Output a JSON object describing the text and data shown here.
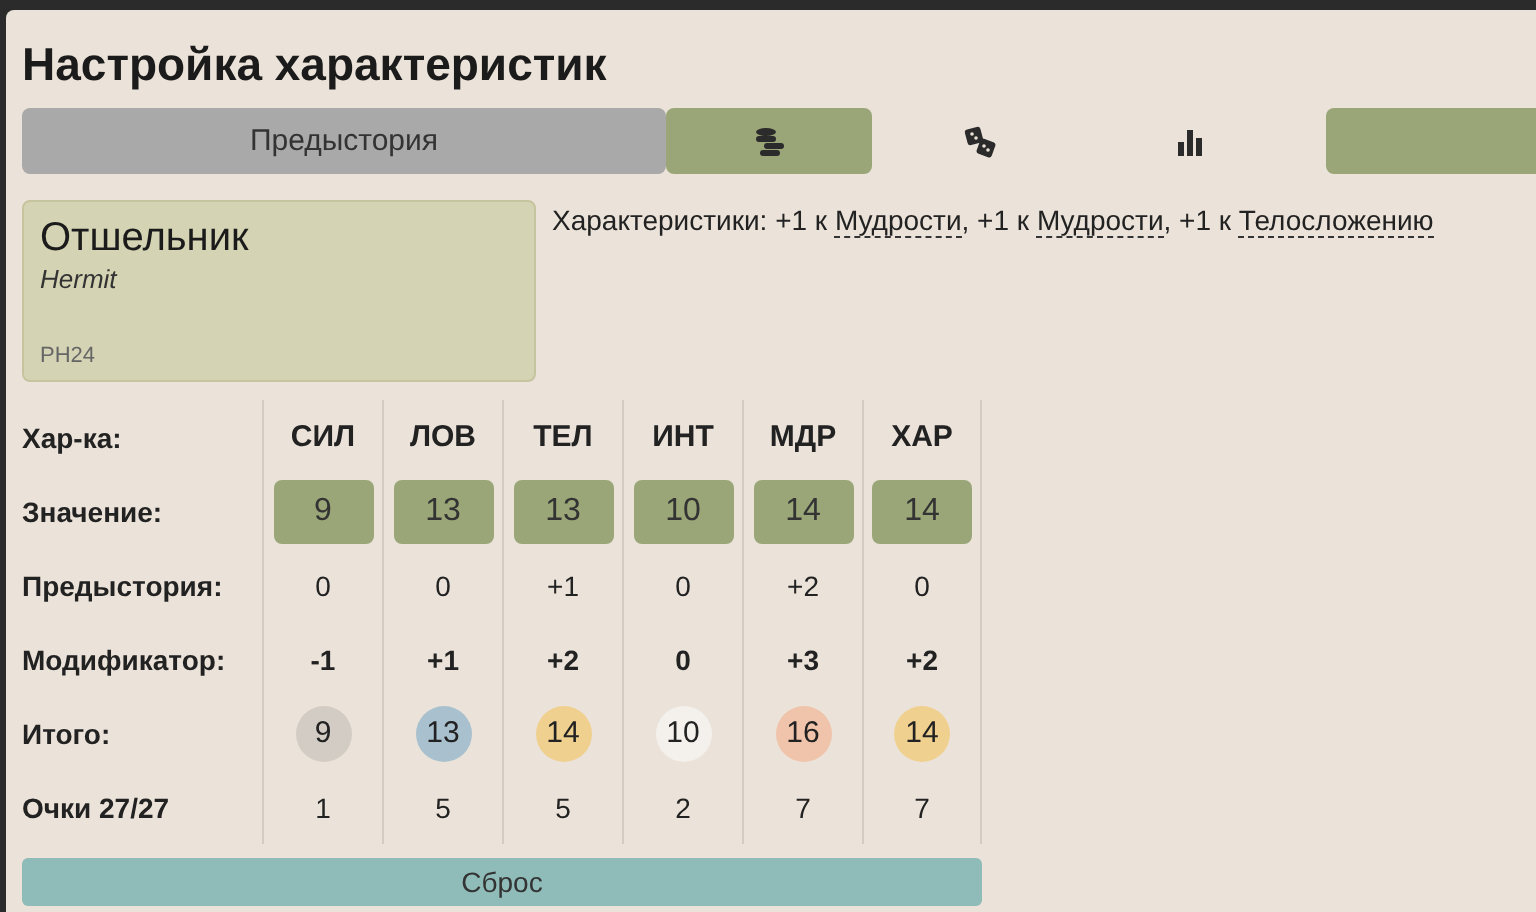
{
  "title": "Настройка характеристик",
  "background_button": {
    "label": "Предыстория"
  },
  "modes": [
    {
      "kind": "coins",
      "selected": true
    },
    {
      "kind": "dice",
      "selected": false
    },
    {
      "kind": "chart",
      "selected": false
    }
  ],
  "background_card": {
    "name": "Отшельник",
    "original_name": "Hermit",
    "source": "PH24"
  },
  "bonus_text": [
    {
      "kind": "plain",
      "text": "Характеристики: +1 к "
    },
    {
      "kind": "link",
      "text": "Мудрости"
    },
    {
      "kind": "plain",
      "text": ", +1 к "
    },
    {
      "kind": "link",
      "text": "Мудрости"
    },
    {
      "kind": "plain",
      "text": ", +1 к "
    },
    {
      "kind": "link",
      "text": "Телосложению"
    }
  ],
  "table": {
    "row_labels": [
      "Хар-ка:",
      "Значение:",
      "Предыстория:",
      "Модификатор:",
      "Итого:",
      "Очки 27/27"
    ],
    "columns": [
      {
        "ability": "СИЛ",
        "value": "9",
        "background": "0",
        "modifier": "-1",
        "total": "9",
        "color": "#d3ccc4",
        "cost": "1"
      },
      {
        "ability": "ЛОВ",
        "value": "13",
        "background": "0",
        "modifier": "+1",
        "total": "13",
        "color": "#a9c1cf",
        "cost": "5"
      },
      {
        "ability": "ТЕЛ",
        "value": "13",
        "background": "+1",
        "modifier": "+2",
        "total": "14",
        "color": "#f0d08f",
        "cost": "5"
      },
      {
        "ability": "ИНТ",
        "value": "10",
        "background": "0",
        "modifier": "0",
        "total": "10",
        "color": "#f4f0ec",
        "cost": "2"
      },
      {
        "ability": "МДР",
        "value": "14",
        "background": "+2",
        "modifier": "+3",
        "total": "16",
        "color": "#f0c4aa",
        "cost": "7"
      },
      {
        "ability": "ХАР",
        "value": "14",
        "background": "0",
        "modifier": "+2",
        "total": "14",
        "color": "#f0d08f",
        "cost": "7"
      }
    ]
  },
  "reset_button": {
    "label": "Сброс"
  }
}
